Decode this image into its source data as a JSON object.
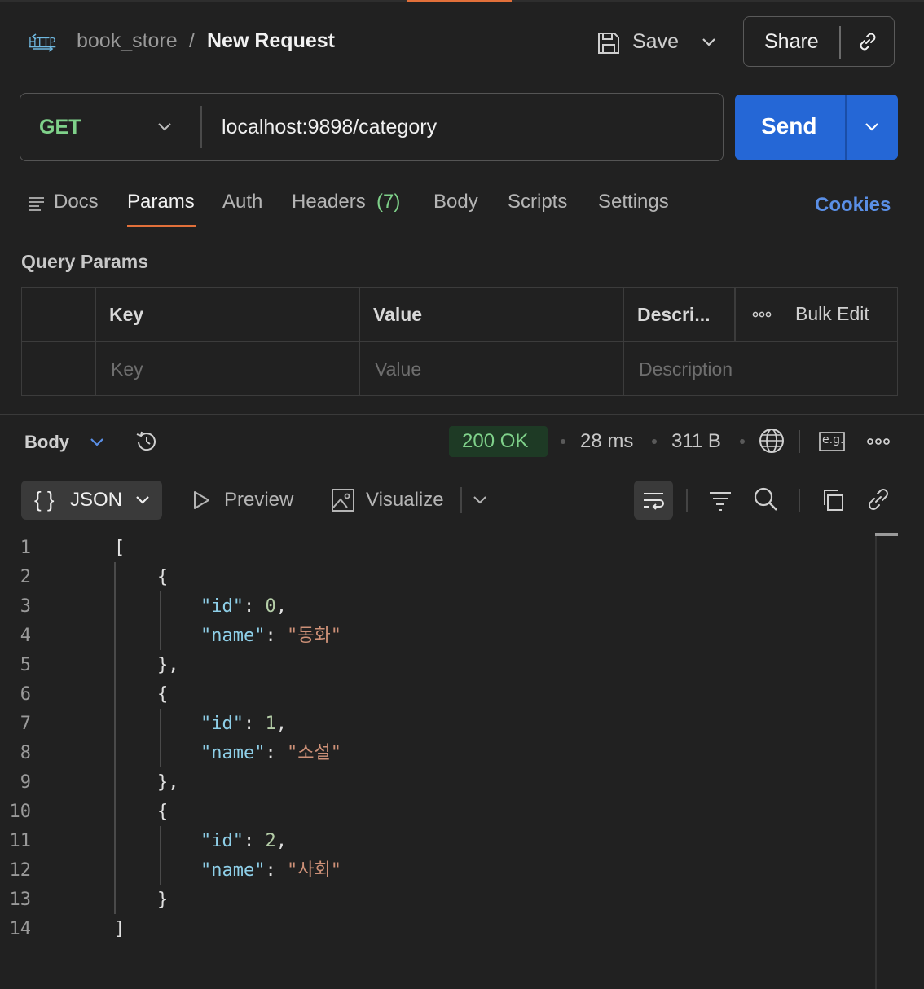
{
  "header": {
    "breadcrumb_collection": "book_store",
    "breadcrumb_separator": "/",
    "request_title": "New Request",
    "save_label": "Save",
    "share_label": "Share"
  },
  "request": {
    "method": "GET",
    "url": "localhost:9898/category",
    "send_label": "Send"
  },
  "tabs": {
    "docs": "Docs",
    "params": "Params",
    "auth": "Auth",
    "headers": "Headers",
    "headers_count": "(7)",
    "body": "Body",
    "scripts": "Scripts",
    "settings": "Settings",
    "cookies": "Cookies",
    "active": "Params"
  },
  "query_params": {
    "title": "Query Params",
    "columns": [
      "Key",
      "Value",
      "Descri..."
    ],
    "bulk_edit": "Bulk Edit",
    "placeholders": {
      "key": "Key",
      "value": "Value",
      "description": "Description"
    }
  },
  "response": {
    "body_label": "Body",
    "status": "200 OK",
    "time": "28 ms",
    "size": "311 B",
    "format_label": "JSON",
    "format_braces": "{ }",
    "preview_label": "Preview",
    "visualize_label": "Visualize",
    "eg_label": "e.g."
  },
  "code_lines": [
    "1",
    "2",
    "3",
    "4",
    "5",
    "6",
    "7",
    "8",
    "9",
    "10",
    "11",
    "12",
    "13",
    "14"
  ],
  "json_body": [
    {
      "id": 0,
      "name": "동화"
    },
    {
      "id": 1,
      "name": "소설"
    },
    {
      "id": 2,
      "name": "사회"
    }
  ],
  "colors": {
    "accent": "#e2703a",
    "send": "#2567d6",
    "get": "#7fd18a",
    "cookies": "#5a8fe6",
    "status_ok": "#7fd18a"
  }
}
